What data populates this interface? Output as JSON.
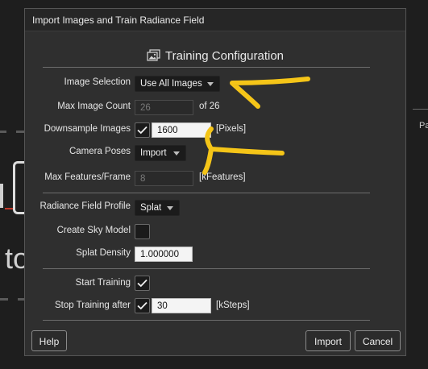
{
  "background": {
    "partial_text": "to",
    "side_label": "Pa"
  },
  "dialog": {
    "title": "Import Images and Train Radiance Field",
    "heading": "Training Configuration",
    "heading_icon": "image-stack-icon",
    "image_selection": {
      "label": "Image Selection",
      "value": "Use All Images"
    },
    "max_image_count": {
      "label": "Max Image Count",
      "value": "26",
      "suffix": "of 26"
    },
    "downsample_images": {
      "label": "Downsample Images",
      "checked": true,
      "value": "1600",
      "unit": "[Pixels]"
    },
    "camera_poses": {
      "label": "Camera Poses",
      "value": "Import"
    },
    "max_features": {
      "label": "Max Features/Frame",
      "value": "8",
      "unit": "[kFeatures]"
    },
    "radiance_profile": {
      "label": "Radiance Field Profile",
      "value": "Splat"
    },
    "create_sky_model": {
      "label": "Create Sky Model",
      "checked": false
    },
    "splat_density": {
      "label": "Splat Density",
      "value": "1.000000"
    },
    "start_training": {
      "label": "Start Training",
      "checked": true
    },
    "stop_training": {
      "label": "Stop Training after",
      "checked": true,
      "value": "30",
      "unit": "[kSteps]"
    },
    "buttons": {
      "help": "Help",
      "import": "Import",
      "cancel": "Cancel"
    }
  },
  "annotation_color": "#f5c518"
}
